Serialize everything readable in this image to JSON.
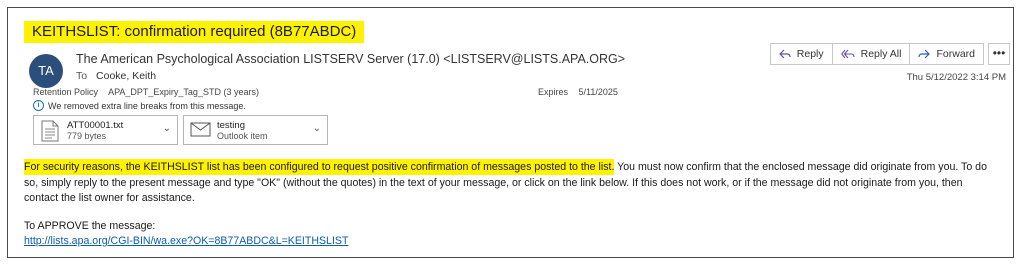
{
  "subject": "KEITHSLIST: confirmation required (8B77ABDC)",
  "sender": {
    "initials": "TA",
    "avatar_color": "#2b4f7a",
    "display": "The American Psychological Association LISTSERV Server (17.0) <LISTSERV@LISTS.APA.ORG>",
    "to_label": "To",
    "to_value": "Cooke, Keith"
  },
  "actions": {
    "reply": "Reply",
    "reply_all": "Reply All",
    "forward": "Forward",
    "more": "•••"
  },
  "date": "Thu 5/12/2022 3:14 PM",
  "retention": {
    "label": "Retention Policy",
    "value": "APA_DPT_Expiry_Tag_STD (3 years)",
    "expires_label": "Expires",
    "expires_value": "5/11/2025"
  },
  "info_message": "We removed extra line breaks from this message.",
  "attachments": [
    {
      "name": "ATT00001.txt",
      "detail": "779 bytes",
      "icon": "text-file-icon"
    },
    {
      "name": "testing",
      "detail": "Outlook item",
      "icon": "envelope-icon"
    }
  ],
  "body": {
    "highlighted": "For  security reasons,  the  KEITHSLIST  list has  been  configured to  request positive confirmation of messages posted to the list.",
    "rest": " You must now confirm that the enclosed  message did  originate from you.  To do so,  simply reply  to the present message and type \"OK\" (without the quotes) in the text of your message, or click on  the link below. If this  does not work, or if the  message did not originate from you, then contact the list owner for assistance.",
    "approve_label": "To APPROVE the message:",
    "approve_link": "http://lists.apa.org/CGI-BIN/wa.exe?OK=8B77ABDC&L=KEITHSLIST"
  },
  "colors": {
    "highlight": "#fff200",
    "link": "#0b5ea8",
    "reply_icon": "#6b4fa0",
    "forward_icon": "#2a63b0"
  }
}
